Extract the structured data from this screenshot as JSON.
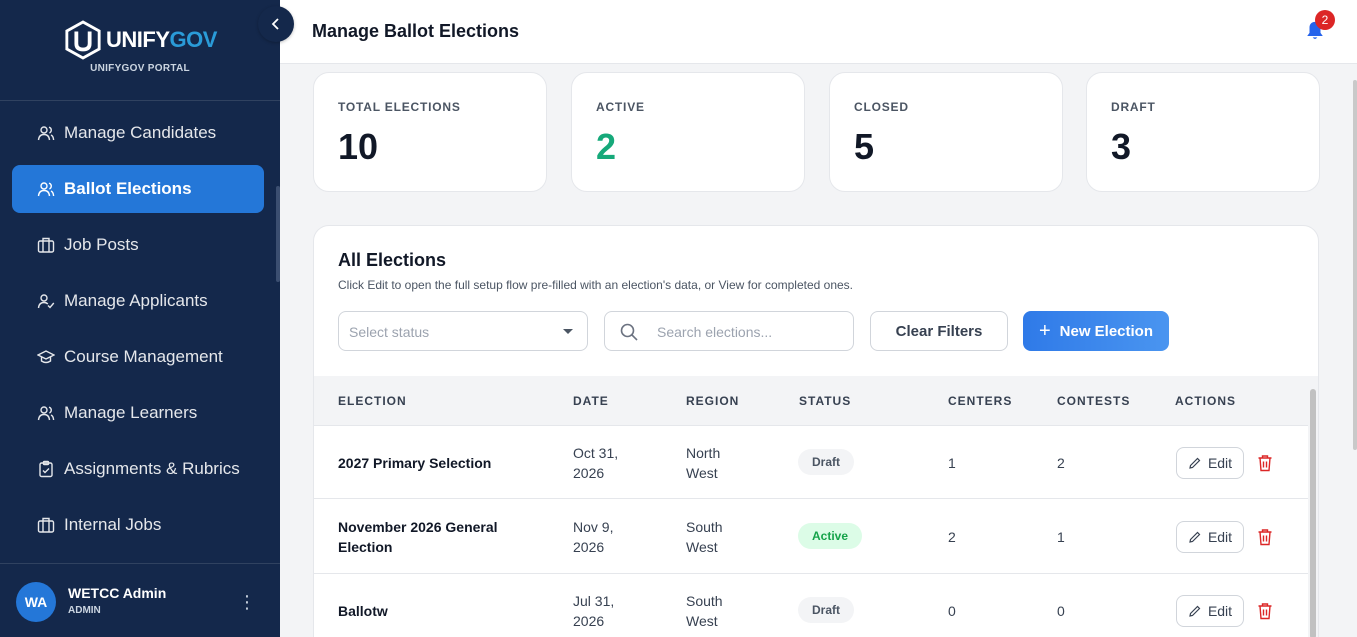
{
  "brand": {
    "name_part1": "UNIFY",
    "name_part2": "GOV",
    "portal": "UNIFYGOV PORTAL"
  },
  "sidebar": {
    "items": [
      {
        "label": "Manage Candidates",
        "icon": "users-icon"
      },
      {
        "label": "Ballot Elections",
        "icon": "users-icon",
        "active": true
      },
      {
        "label": "Job Posts",
        "icon": "briefcase-icon"
      },
      {
        "label": "Manage Applicants",
        "icon": "user-check-icon"
      },
      {
        "label": "Course Management",
        "icon": "graduation-cap-icon"
      },
      {
        "label": "Manage Learners",
        "icon": "users-icon"
      },
      {
        "label": "Assignments & Rubrics",
        "icon": "clipboard-check-icon"
      },
      {
        "label": "Internal Jobs",
        "icon": "briefcase-icon"
      }
    ]
  },
  "user": {
    "initials": "WA",
    "name": "WETCC Admin",
    "role": "ADMIN"
  },
  "header": {
    "title": "Manage Ballot Elections",
    "notification_count": "2"
  },
  "stats": [
    {
      "label": "TOTAL ELECTIONS",
      "value": "10",
      "color": "#111827"
    },
    {
      "label": "ACTIVE",
      "value": "2",
      "color": "#16a97a"
    },
    {
      "label": "CLOSED",
      "value": "5",
      "color": "#111827"
    },
    {
      "label": "DRAFT",
      "value": "3",
      "color": "#111827"
    }
  ],
  "elections": {
    "title": "All Elections",
    "subtitle": "Click Edit to open the full setup flow pre-filled with an election's data, or View for completed ones.",
    "status_placeholder": "Select status",
    "search_placeholder": "Search elections...",
    "clear_label": "Clear Filters",
    "new_label": "New Election",
    "columns": [
      "ELECTION",
      "DATE",
      "REGION",
      "STATUS",
      "CENTERS",
      "CONTESTS",
      "ACTIONS"
    ],
    "edit_label": "Edit",
    "rows": [
      {
        "name": "2027 Primary Selection",
        "date": "Oct 31,\n2026",
        "region": "North\nWest",
        "status": "Draft",
        "centers": "1",
        "contests": "2"
      },
      {
        "name": "November 2026 General\nElection",
        "date": "Nov 9,\n2026",
        "region": "South\nWest",
        "status": "Active",
        "centers": "2",
        "contests": "1"
      },
      {
        "name": "Ballotw",
        "date": "Jul 31,\n2026",
        "region": "South\nWest",
        "status": "Draft",
        "centers": "0",
        "contests": "0"
      }
    ]
  }
}
